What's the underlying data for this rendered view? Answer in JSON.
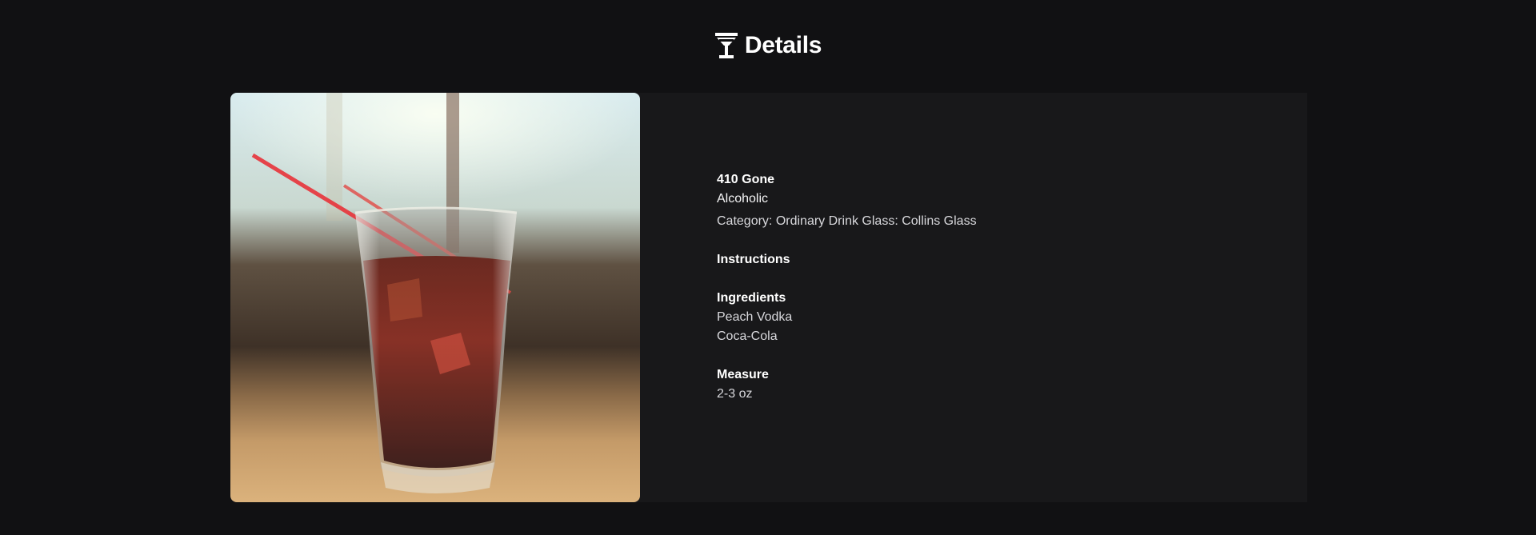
{
  "header": {
    "title": "Details",
    "icon": "cocktail-glass-icon"
  },
  "drink": {
    "name": "410 Gone",
    "alcoholic": "Alcoholic",
    "category_label": "Category:",
    "category": "Ordinary Drink",
    "glass_label": "Glass:",
    "glass": "Collins Glass",
    "image_alt": "410 Gone",
    "instructions_title": "Instructions",
    "instructions": "",
    "ingredients_title": "Ingredients",
    "ingredients": [
      "Peach Vodka",
      "Coca-Cola"
    ],
    "measure_title": "Measure",
    "measures": [
      "2-3 oz"
    ]
  },
  "colors": {
    "background": "#111113",
    "card": "#18181a",
    "text": "#ffffff",
    "muted_text": "#d8d8dc"
  }
}
